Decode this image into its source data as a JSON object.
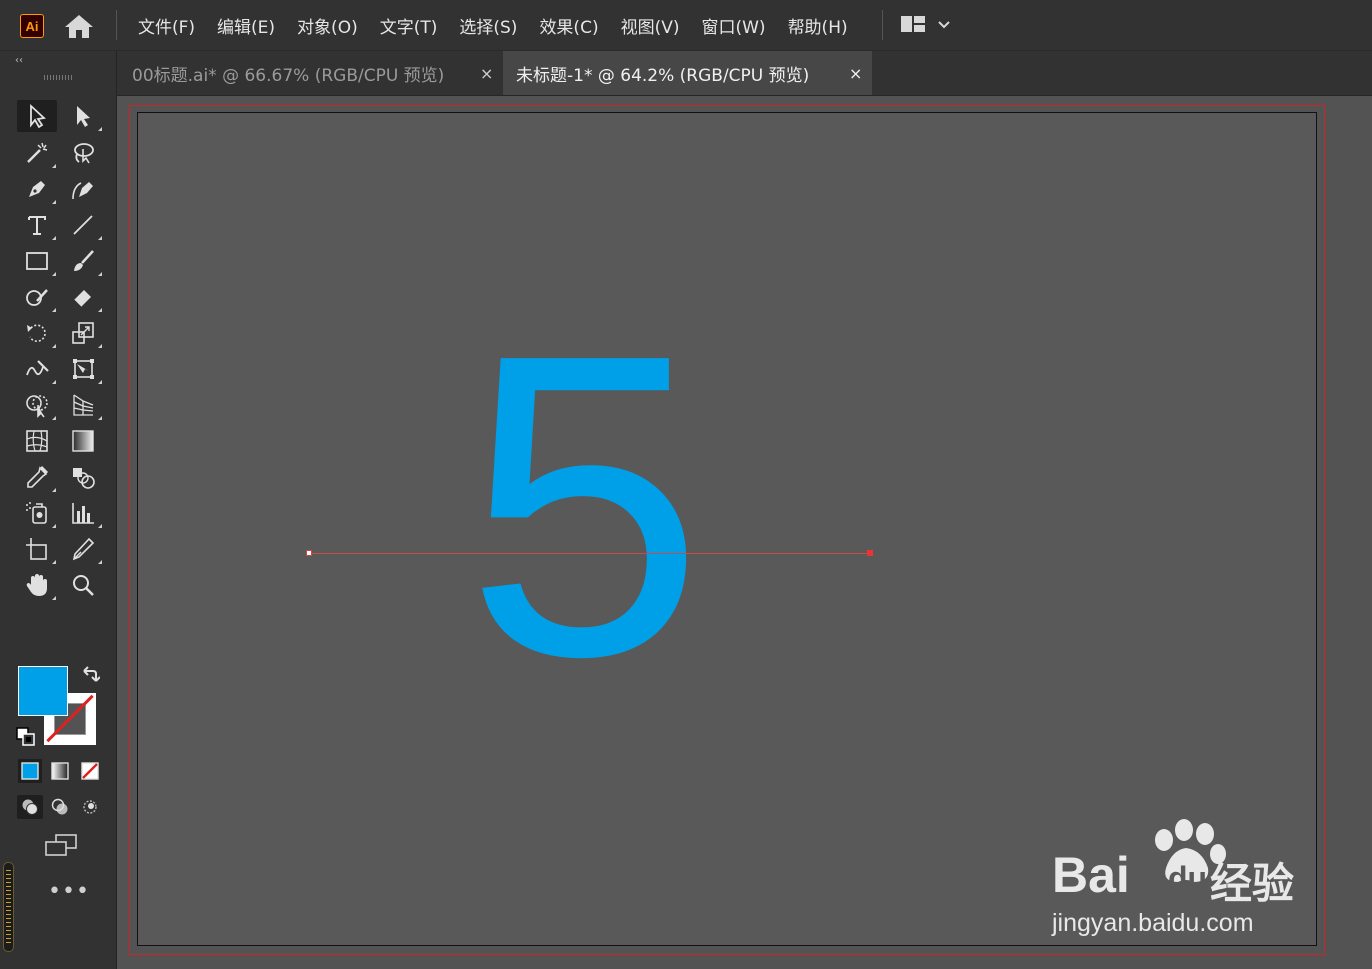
{
  "app": {
    "logo": "Ai",
    "home_icon": "home-icon"
  },
  "menu": [
    {
      "label": "文件(F)"
    },
    {
      "label": "编辑(E)"
    },
    {
      "label": "对象(O)"
    },
    {
      "label": "文字(T)"
    },
    {
      "label": "选择(S)"
    },
    {
      "label": "效果(C)"
    },
    {
      "label": "视图(V)"
    },
    {
      "label": "窗口(W)"
    },
    {
      "label": "帮助(H)"
    }
  ],
  "tabs": [
    {
      "label": "00标题.ai* @ 66.67% (RGB/CPU 预览)",
      "close": "×",
      "active": false
    },
    {
      "label": "未标题-1* @ 64.2% (RGB/CPU 预览)",
      "close": "×",
      "active": true
    }
  ],
  "toolbar": {
    "collapse_label": "‹‹",
    "more_label": "•••",
    "fill_color": "#00a0e9",
    "stroke_color": "none"
  },
  "artboard": {
    "text": "5",
    "text_color": "#00a0e9",
    "guide_color": "#c84a4a"
  },
  "watermark": {
    "brand": "Bai",
    "brand_suffix": "du",
    "product": "经验",
    "url": "jingyan.baidu.com"
  }
}
